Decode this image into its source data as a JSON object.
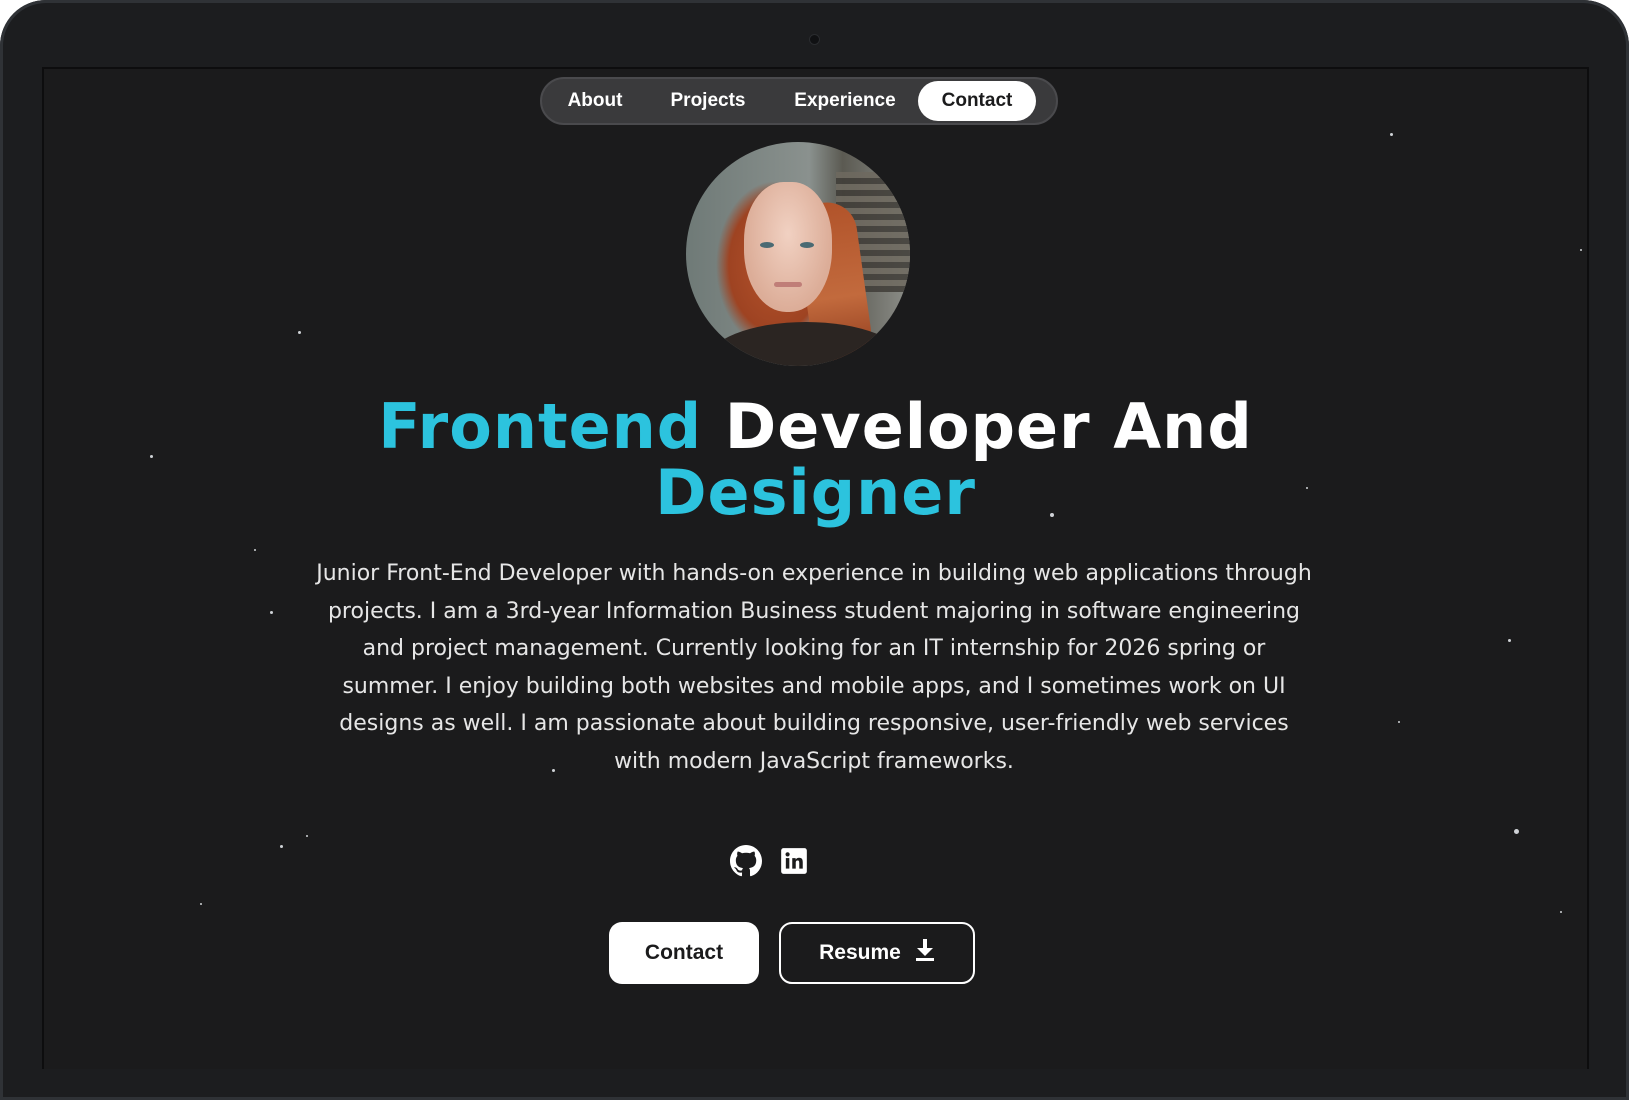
{
  "nav": {
    "items": [
      {
        "label": "About",
        "active": false
      },
      {
        "label": "Projects",
        "active": false
      },
      {
        "label": "Experience",
        "active": false
      },
      {
        "label": "Contact",
        "active": true
      }
    ]
  },
  "hero": {
    "headline_accent_1": "Frontend",
    "headline_plain": " Developer And",
    "headline_accent_2": "Designer",
    "bio": "Junior Front-End Developer with hands-on experience in building web applications through projects. I am a 3rd-year Information Business student majoring in software engineering and project management. Currently looking for an IT internship for 2026 spring or summer. I enjoy building both websites and mobile apps, and I sometimes work on UI designs as well. I am passionate about building responsive, user-friendly web services with modern JavaScript frameworks."
  },
  "social": {
    "icons": [
      "github-icon",
      "linkedin-icon"
    ]
  },
  "actions": {
    "contact_label": "Contact",
    "resume_label": "Resume",
    "resume_icon": "download-icon"
  },
  "colors": {
    "accent": "#2cc3de",
    "background": "#1b1b1c",
    "nav_background": "#3a3a3c",
    "text": "#ffffff"
  }
}
